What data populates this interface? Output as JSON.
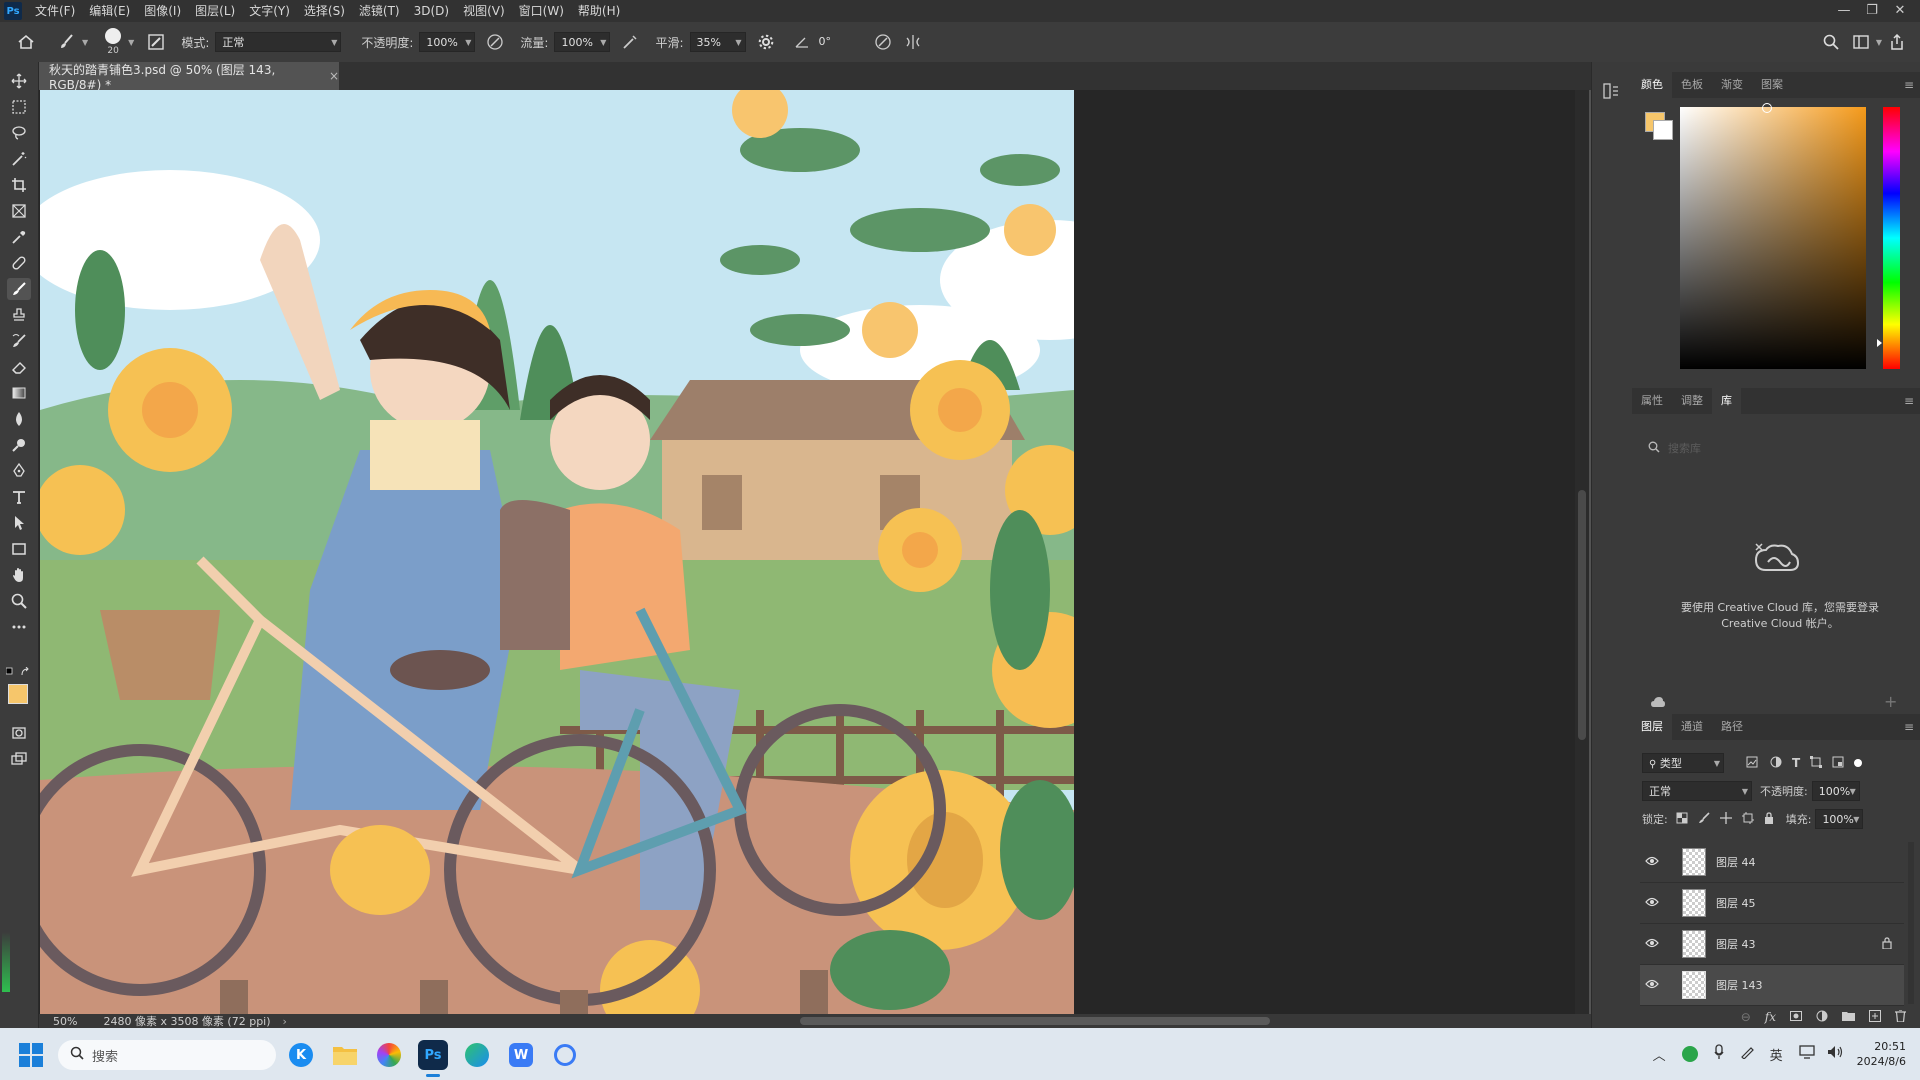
{
  "menu": [
    "文件(F)",
    "编辑(E)",
    "图像(I)",
    "图层(L)",
    "文字(Y)",
    "选择(S)",
    "滤镜(T)",
    "3D(D)",
    "视图(V)",
    "窗口(W)",
    "帮助(H)"
  ],
  "app_logo": "Ps",
  "options": {
    "brush_size": "20",
    "mode_label": "模式:",
    "mode_value": "正常",
    "opacity_label": "不透明度:",
    "opacity_value": "100%",
    "flow_label": "流量:",
    "flow_value": "100%",
    "smooth_label": "平滑:",
    "smooth_value": "35%",
    "angle_value": "0°"
  },
  "document": {
    "tab_title": "秋天的踏青铺色3.psd @ 50% (图层 143, RGB/8#) *",
    "close": "×"
  },
  "status": {
    "zoom": "50%",
    "doc_info": "2480 像素 x 3508 像素 (72 ppi)"
  },
  "color_panel": {
    "tabs": [
      "颜色",
      "色板",
      "渐变",
      "图案"
    ],
    "active_tab": 0,
    "foreground": "#f6c66b",
    "background": "#ffffff"
  },
  "library_panel": {
    "tabs": [
      "属性",
      "调整",
      "库"
    ],
    "active_tab": 2,
    "search_placeholder": "搜索库",
    "message": "要使用 Creative Cloud 库，您需要登录 Creative Cloud 帐户。"
  },
  "layers_panel": {
    "tabs": [
      "图层",
      "通道",
      "路径"
    ],
    "active_tab": 0,
    "filter_label": "类型",
    "blend_mode": "正常",
    "opacity_label": "不透明度:",
    "opacity_value": "100%",
    "lock_label": "锁定:",
    "fill_label": "填充:",
    "fill_value": "100%",
    "layers": [
      {
        "name": "图层 44",
        "locked": false,
        "selected": false
      },
      {
        "name": "图层 45",
        "locked": false,
        "selected": false
      },
      {
        "name": "图层 43",
        "locked": true,
        "selected": false
      },
      {
        "name": "图层 143",
        "locked": false,
        "selected": true
      }
    ]
  },
  "taskbar": {
    "search_label": "搜索",
    "ime": "英",
    "time": "20:51",
    "date": "2024/8/6"
  },
  "colors": {
    "canvas_sky": "#bfe2ef",
    "accent_ps": "#31a8ff"
  }
}
